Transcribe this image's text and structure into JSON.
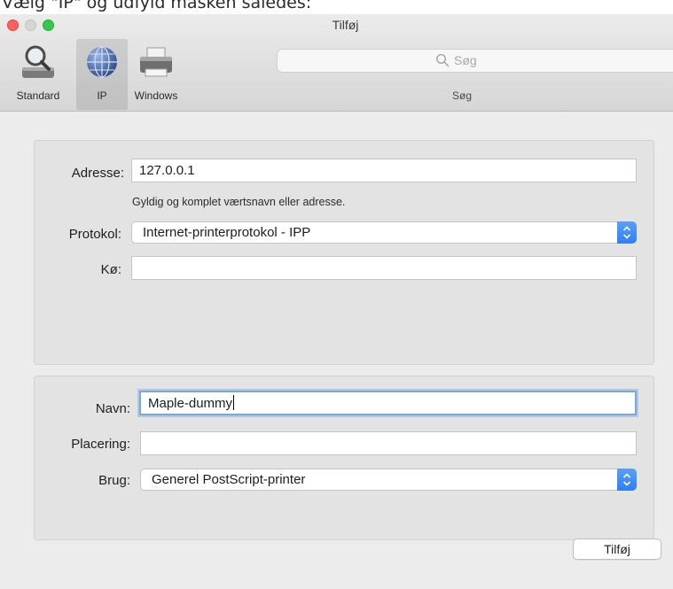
{
  "caption": "Vælg \"IP\" og udfyld masken således:",
  "window": {
    "title": "Tilføj",
    "toolbar": {
      "items": [
        {
          "label": "Standard",
          "icon": "magnifier-printer-icon"
        },
        {
          "label": "IP",
          "icon": "globe-icon",
          "selected": true
        },
        {
          "label": "Windows",
          "icon": "printer-icon"
        }
      ],
      "search": {
        "placeholder": "Søg",
        "label": "Søg"
      }
    }
  },
  "connection": {
    "address": {
      "label": "Adresse:",
      "value": "127.0.0.1",
      "hint": "Gyldig og komplet værtsnavn eller adresse."
    },
    "protocol": {
      "label": "Protokol:",
      "value": "Internet-printerprotokol - IPP"
    },
    "queue": {
      "label": "Kø:",
      "value": ""
    }
  },
  "printer": {
    "name": {
      "label": "Navn:",
      "value": "Maple-dummy"
    },
    "location": {
      "label": "Placering:",
      "value": ""
    },
    "use": {
      "label": "Brug:",
      "value": "Generel PostScript-printer"
    }
  },
  "actions": {
    "add_label": "Tilføj"
  },
  "colors": {
    "accent": "#2f7ff2",
    "close": "#fc605c",
    "zoom": "#34c84a"
  }
}
